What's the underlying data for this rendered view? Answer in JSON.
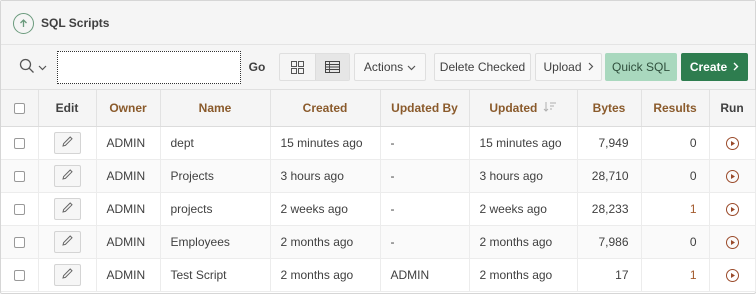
{
  "region": {
    "title": "SQL Scripts"
  },
  "toolbar": {
    "search_value": "",
    "go_label": "Go",
    "actions_label": "Actions",
    "delete_label": "Delete Checked",
    "upload_label": "Upload",
    "quick_sql_label": "Quick SQL",
    "create_label": "Create"
  },
  "table": {
    "columns": [
      "Edit",
      "Owner",
      "Name",
      "Created",
      "Updated By",
      "Updated",
      "Bytes",
      "Results",
      "Run"
    ],
    "rows": [
      {
        "owner": "ADMIN",
        "name": "dept",
        "created": "15 minutes ago",
        "updated_by": "-",
        "updated": "15 minutes ago",
        "bytes": "7,949",
        "results": "0"
      },
      {
        "owner": "ADMIN",
        "name": "Projects",
        "created": "3 hours ago",
        "updated_by": "-",
        "updated": "3 hours ago",
        "bytes": "28,710",
        "results": "0"
      },
      {
        "owner": "ADMIN",
        "name": "projects",
        "created": "2 weeks ago",
        "updated_by": "-",
        "updated": "2 weeks ago",
        "bytes": "28,233",
        "results": "1"
      },
      {
        "owner": "ADMIN",
        "name": "Employees",
        "created": "2 months ago",
        "updated_by": "-",
        "updated": "2 months ago",
        "bytes": "7,986",
        "results": "0"
      },
      {
        "owner": "ADMIN",
        "name": "Test Script",
        "created": "2 months ago",
        "updated_by": "ADMIN",
        "updated": "2 months ago",
        "bytes": "17",
        "results": "1"
      }
    ]
  },
  "colors": {
    "accent": "#2e7d4f",
    "quick_sql": "#a9d8be",
    "link": "#a35a2c",
    "header_text": "#8a5a2b"
  },
  "icons": [
    "collapse-up-icon",
    "search-icon",
    "chevron-down-icon",
    "icons-view-icon",
    "report-view-icon",
    "chevron-right-icon",
    "pencil-icon",
    "play-icon",
    "sort-desc-icon"
  ]
}
